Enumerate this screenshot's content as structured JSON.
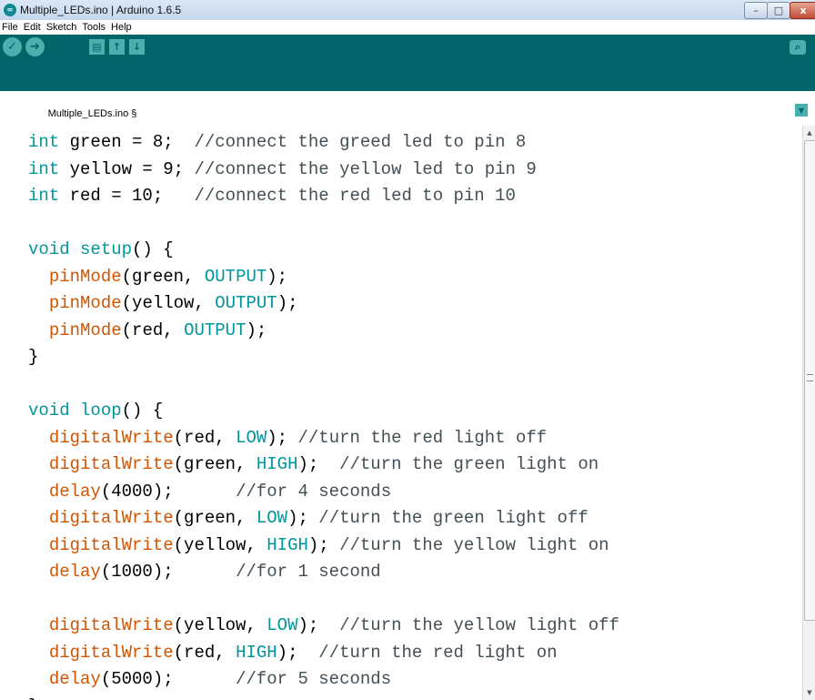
{
  "window": {
    "title": "Multiple_LEDs.ino | Arduino 1.6.5",
    "app_icon_glyph": "∞",
    "minimize_glyph": "–",
    "maximize_glyph": "□",
    "close_glyph": "x"
  },
  "menu": [
    "File",
    "Edit",
    "Sketch",
    "Tools",
    "Help"
  ],
  "toolbar": {
    "verify_glyph": "✓",
    "upload_glyph": "➜",
    "new_glyph": "▤",
    "open_glyph": "↑",
    "save_glyph": "↓",
    "serial_monitor_glyph": "⌕"
  },
  "tab": {
    "label": "Multiple_LEDs.ino §",
    "menu_glyph": "▼"
  },
  "colors": {
    "toolbar_bg": "#006468",
    "button_bg": "#49b0ae",
    "keyword": "#00979c",
    "function": "#d35400",
    "comment": "#434f54"
  },
  "code_lines": [
    [
      {
        "t": "int",
        "c": "keyword"
      },
      {
        "t": " green = 8;  ",
        "c": "plain"
      },
      {
        "t": "//connect the greed led to pin 8",
        "c": "comment"
      }
    ],
    [
      {
        "t": "int",
        "c": "keyword"
      },
      {
        "t": " yellow = 9; ",
        "c": "plain"
      },
      {
        "t": "//connect the yellow led to pin 9",
        "c": "comment"
      }
    ],
    [
      {
        "t": "int",
        "c": "keyword"
      },
      {
        "t": " red = 10;   ",
        "c": "plain"
      },
      {
        "t": "//connect the red led to pin 10",
        "c": "comment"
      }
    ],
    [],
    [
      {
        "t": "void",
        "c": "keyword"
      },
      {
        "t": " ",
        "c": "plain"
      },
      {
        "t": "setup",
        "c": "keyword"
      },
      {
        "t": "() {",
        "c": "plain"
      }
    ],
    [
      {
        "t": "  ",
        "c": "plain"
      },
      {
        "t": "pinMode",
        "c": "function"
      },
      {
        "t": "(green, ",
        "c": "plain"
      },
      {
        "t": "OUTPUT",
        "c": "constant"
      },
      {
        "t": ");",
        "c": "plain"
      }
    ],
    [
      {
        "t": "  ",
        "c": "plain"
      },
      {
        "t": "pinMode",
        "c": "function"
      },
      {
        "t": "(yellow, ",
        "c": "plain"
      },
      {
        "t": "OUTPUT",
        "c": "constant"
      },
      {
        "t": ");",
        "c": "plain"
      }
    ],
    [
      {
        "t": "  ",
        "c": "plain"
      },
      {
        "t": "pinMode",
        "c": "function"
      },
      {
        "t": "(red, ",
        "c": "plain"
      },
      {
        "t": "OUTPUT",
        "c": "constant"
      },
      {
        "t": ");",
        "c": "plain"
      }
    ],
    [
      {
        "t": "}",
        "c": "plain"
      }
    ],
    [],
    [
      {
        "t": "void",
        "c": "keyword"
      },
      {
        "t": " ",
        "c": "plain"
      },
      {
        "t": "loop",
        "c": "keyword"
      },
      {
        "t": "() {",
        "c": "plain"
      }
    ],
    [
      {
        "t": "  ",
        "c": "plain"
      },
      {
        "t": "digitalWrite",
        "c": "function"
      },
      {
        "t": "(red, ",
        "c": "plain"
      },
      {
        "t": "LOW",
        "c": "constant"
      },
      {
        "t": "); ",
        "c": "plain"
      },
      {
        "t": "//turn the red light off",
        "c": "comment"
      }
    ],
    [
      {
        "t": "  ",
        "c": "plain"
      },
      {
        "t": "digitalWrite",
        "c": "function"
      },
      {
        "t": "(green, ",
        "c": "plain"
      },
      {
        "t": "HIGH",
        "c": "constant"
      },
      {
        "t": ");  ",
        "c": "plain"
      },
      {
        "t": "//turn the green light on",
        "c": "comment"
      }
    ],
    [
      {
        "t": "  ",
        "c": "plain"
      },
      {
        "t": "delay",
        "c": "function"
      },
      {
        "t": "(4000);      ",
        "c": "plain"
      },
      {
        "t": "//for 4 seconds",
        "c": "comment"
      }
    ],
    [
      {
        "t": "  ",
        "c": "plain"
      },
      {
        "t": "digitalWrite",
        "c": "function"
      },
      {
        "t": "(green, ",
        "c": "plain"
      },
      {
        "t": "LOW",
        "c": "constant"
      },
      {
        "t": "); ",
        "c": "plain"
      },
      {
        "t": "//turn the green light off",
        "c": "comment"
      }
    ],
    [
      {
        "t": "  ",
        "c": "plain"
      },
      {
        "t": "digitalWrite",
        "c": "function"
      },
      {
        "t": "(yellow, ",
        "c": "plain"
      },
      {
        "t": "HIGH",
        "c": "constant"
      },
      {
        "t": "); ",
        "c": "plain"
      },
      {
        "t": "//turn the yellow light on",
        "c": "comment"
      }
    ],
    [
      {
        "t": "  ",
        "c": "plain"
      },
      {
        "t": "delay",
        "c": "function"
      },
      {
        "t": "(1000);      ",
        "c": "plain"
      },
      {
        "t": "//for 1 second",
        "c": "comment"
      }
    ],
    [],
    [
      {
        "t": "  ",
        "c": "plain"
      },
      {
        "t": "digitalWrite",
        "c": "function"
      },
      {
        "t": "(yellow, ",
        "c": "plain"
      },
      {
        "t": "LOW",
        "c": "constant"
      },
      {
        "t": ");  ",
        "c": "plain"
      },
      {
        "t": "//turn the yellow light off",
        "c": "comment"
      }
    ],
    [
      {
        "t": "  ",
        "c": "plain"
      },
      {
        "t": "digitalWrite",
        "c": "function"
      },
      {
        "t": "(red, ",
        "c": "plain"
      },
      {
        "t": "HIGH",
        "c": "constant"
      },
      {
        "t": ");  ",
        "c": "plain"
      },
      {
        "t": "//turn the red light on",
        "c": "comment"
      }
    ],
    [
      {
        "t": "  ",
        "c": "plain"
      },
      {
        "t": "delay",
        "c": "function"
      },
      {
        "t": "(5000);      ",
        "c": "plain"
      },
      {
        "t": "//for 5 seconds",
        "c": "comment"
      }
    ],
    [
      {
        "t": "}",
        "c": "plain"
      }
    ]
  ],
  "scrollbar": {
    "up_glyph": "▲",
    "down_glyph": "▼"
  }
}
